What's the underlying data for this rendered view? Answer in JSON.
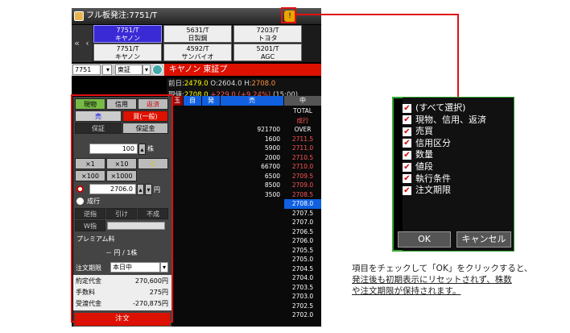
{
  "window": {
    "title": "フル板発注:7751/T",
    "bell_label": "!"
  },
  "nav": {
    "prev": "«",
    "prev2": "‹"
  },
  "tabs": [
    {
      "code": "7751/T",
      "name": "キヤノン",
      "selected": true
    },
    {
      "code": "5631/T",
      "name": "日製鋼",
      "selected": false
    },
    {
      "code": "7203/T",
      "name": "トヨタ",
      "selected": false
    },
    {
      "code": "7751/T",
      "name": "キヤノン",
      "selected": false
    },
    {
      "code": "4592/T",
      "name": "サンバイオ",
      "selected": false
    },
    {
      "code": "5201/T",
      "name": "AGC",
      "selected": false
    }
  ],
  "controls": {
    "code_value": "7751",
    "market_value": "東証",
    "stock_label": "キヤノン 東証プ"
  },
  "prices": {
    "prev_label": "前日:",
    "prev_value": "2479.0",
    "open_label": "O:",
    "open_value": "2604.0",
    "high_label": "H:",
    "high_value": "2708.0",
    "current_label": "現値:",
    "current_value": "2708.0",
    "change": "+229.0 (+9.24%)",
    "time": "(15:00)"
  },
  "order": {
    "tab_cash": "現物",
    "tab_margin": "信用",
    "tab_repay": "返済",
    "sell": "売",
    "buy": "買(一般)",
    "protect": "保証",
    "deposit": "保証金",
    "qty_value": "100",
    "qty_unit": "株",
    "mult1": "×1",
    "mult10": "×10",
    "clear": "C",
    "mult100": "×100",
    "mult1000": "×1000",
    "price_value": "2706.0",
    "price_unit": "円",
    "market_order": "成行",
    "cond1": "逆指",
    "cond2": "引け",
    "cond3": "不成",
    "w_label": "W指",
    "premium_label": "プレミアム料",
    "premium_value": "－ 円 / 1株",
    "period_label": "注文期限",
    "period_value": "本日中",
    "contract_label": "約定代金",
    "contract_value": "270,600円",
    "fee_label": "手数料",
    "fee_value": "275円",
    "settle_label": "受渡代金",
    "settle_value": "-270,875円",
    "submit": "注文"
  },
  "board": {
    "headers": [
      "玉",
      "自",
      "発",
      "売",
      "中"
    ],
    "rows": [
      {
        "qty": "",
        "price": "TOTAL",
        "kind": "label"
      },
      {
        "qty": "",
        "price": "成行",
        "kind": "market"
      },
      {
        "qty": "921700",
        "price": "OVER",
        "kind": "label"
      },
      {
        "qty": "1600",
        "price": "2711.5",
        "kind": "sell"
      },
      {
        "qty": "5900",
        "price": "2711.0",
        "kind": "sell"
      },
      {
        "qty": "2000",
        "price": "2710.5",
        "kind": "sell"
      },
      {
        "qty": "66700",
        "price": "2710.0",
        "kind": "sell"
      },
      {
        "qty": "6500",
        "price": "2709.5",
        "kind": "sell"
      },
      {
        "qty": "8500",
        "price": "2709.0",
        "kind": "sell"
      },
      {
        "qty": "3500",
        "price": "2708.5",
        "kind": "sell"
      },
      {
        "qty": "",
        "price": "2708.0",
        "kind": "current"
      },
      {
        "qty": "",
        "price": "2707.5",
        "kind": "buy"
      },
      {
        "qty": "",
        "price": "2707.0",
        "kind": "buy"
      },
      {
        "qty": "",
        "price": "2706.5",
        "kind": "buy"
      },
      {
        "qty": "",
        "price": "2706.0",
        "kind": "buy"
      },
      {
        "qty": "",
        "price": "2705.5",
        "kind": "buy"
      },
      {
        "qty": "",
        "price": "2705.0",
        "kind": "buy"
      },
      {
        "qty": "",
        "price": "2704.5",
        "kind": "buy"
      },
      {
        "qty": "",
        "price": "2704.0",
        "kind": "buy"
      },
      {
        "qty": "",
        "price": "2703.5",
        "kind": "buy"
      },
      {
        "qty": "",
        "price": "2703.0",
        "kind": "buy"
      },
      {
        "qty": "",
        "price": "2702.5",
        "kind": "buy"
      },
      {
        "qty": "",
        "price": "2702.0",
        "kind": "buy"
      }
    ]
  },
  "popup": {
    "items": [
      "(すべて選択)",
      "現物、信用、返済",
      "売買",
      "信用区分",
      "数量",
      "値段",
      "執行条件",
      "注文期限"
    ],
    "ok": "OK",
    "cancel": "キャンセル"
  },
  "caption": {
    "line1": "項目をチェックして「OK」をクリックすると、",
    "line2": "発注後も初期表示にリセットされず、株数",
    "line3": "や注文期限が保持されます。"
  },
  "colors": {
    "highlight": "#e01010",
    "accent_red": "#d10000",
    "selected_tab": "#3a2ad6",
    "current_price_bg": "#1060e0"
  }
}
